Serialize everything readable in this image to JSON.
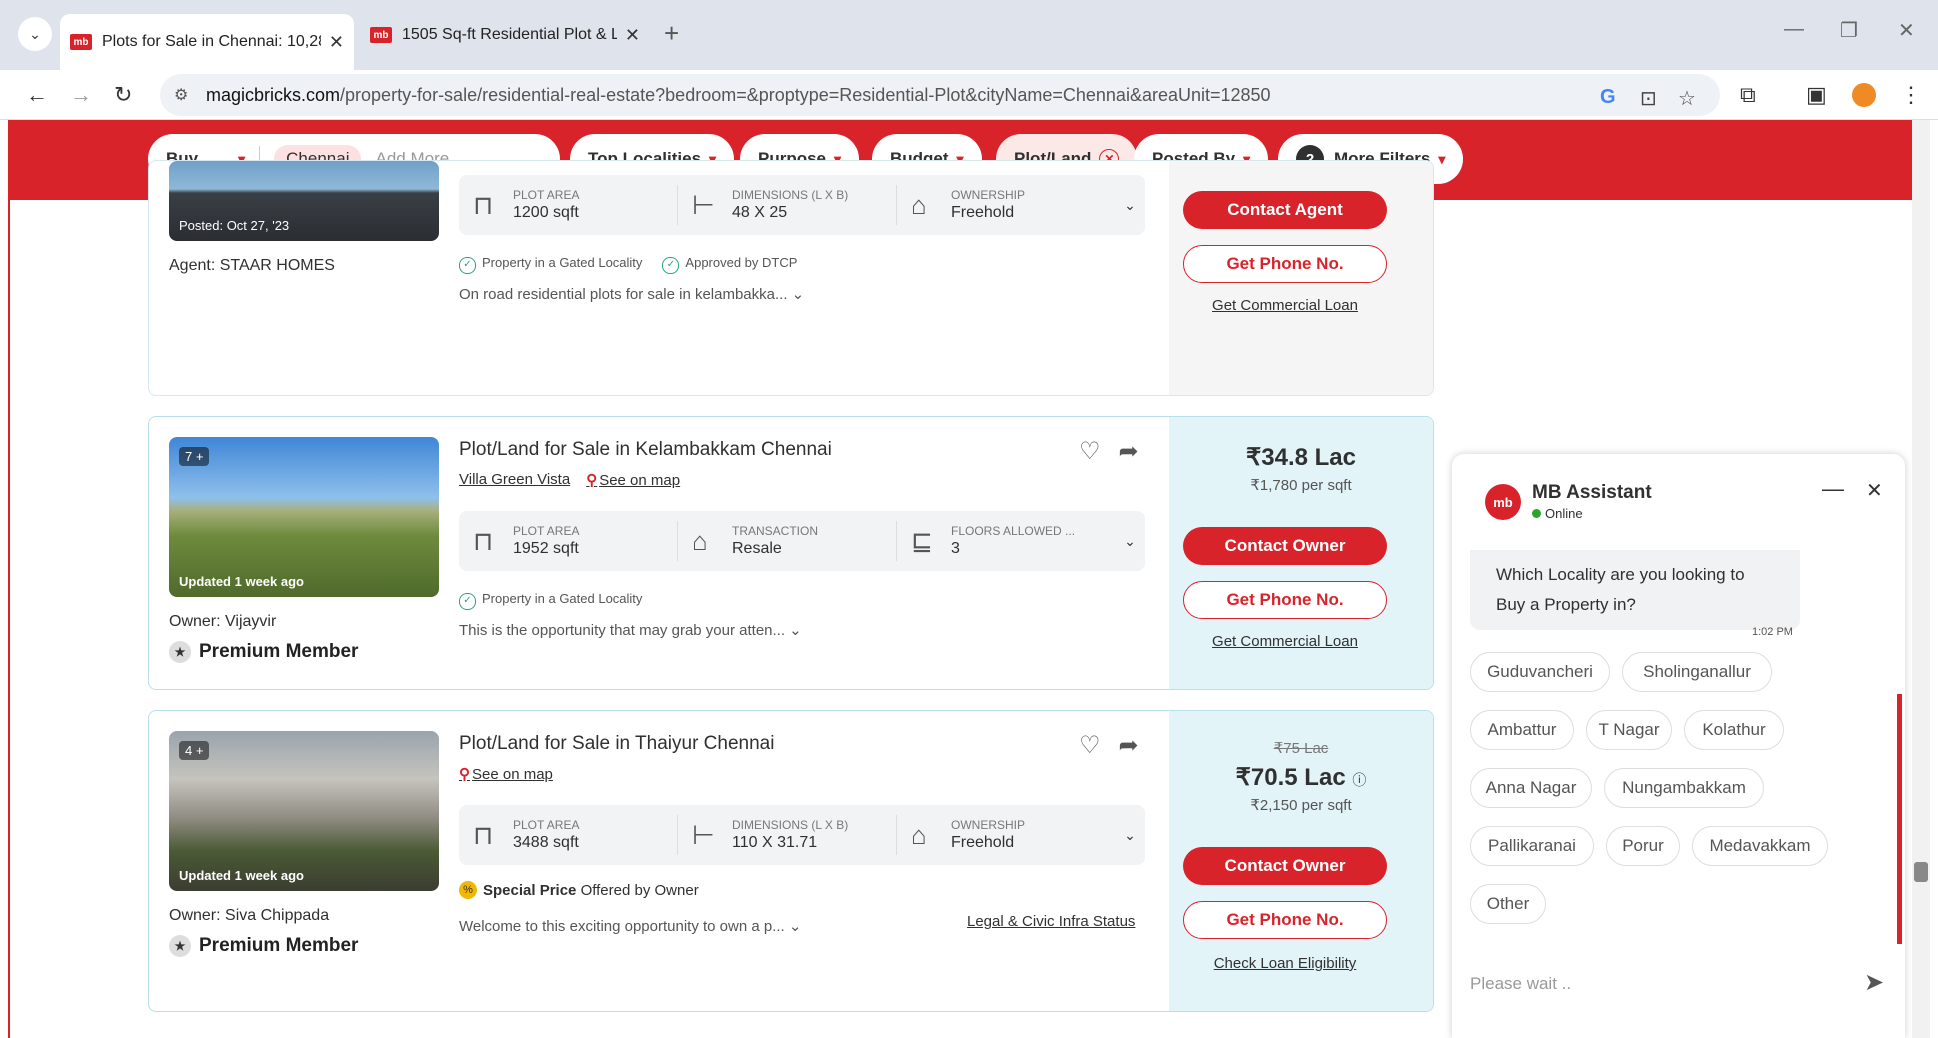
{
  "browser": {
    "tabs": [
      {
        "label": "Plots for Sale in Chennai: 10,28",
        "active": true
      },
      {
        "label": "1505 Sq-ft Residential Plot & L",
        "active": false
      }
    ],
    "url_domain": "magicbricks.com",
    "url_path": "/property-for-sale/residential-real-estate?bedroom=&proptype=Residential-Plot&cityName=Chennai&areaUnit=12850"
  },
  "filters": {
    "buy": "Buy",
    "city": "Chennai",
    "add_more": "Add More",
    "top_localities": "Top Localities",
    "purpose": "Purpose",
    "budget": "Budget",
    "plot_land": "Plot/Land",
    "posted_by": "Posted By",
    "more_filters_count": "2",
    "more_filters": "More Filters"
  },
  "listings": [
    {
      "posted": "Posted: Oct 27, '23",
      "agent": "Agent: STAAR HOMES",
      "specs": [
        {
          "label": "PLOT AREA",
          "value": "1200 sqft"
        },
        {
          "label": "DIMENSIONS (L X B)",
          "value": "48 X 25"
        },
        {
          "label": "OWNERSHIP",
          "value": "Freehold"
        }
      ],
      "tags": [
        "Property in a Gated Locality",
        "Approved by DTCP"
      ],
      "desc": "On road residential plots for sale in kelambakka...",
      "btn1": "Contact Agent",
      "btn2": "Get Phone No.",
      "loan": "Get Commercial Loan"
    },
    {
      "count": "7 +",
      "updated": "Updated 1 week ago",
      "title": "Plot/Land for Sale in Kelambakkam Chennai",
      "project": "Villa Green Vista",
      "map": "See on map",
      "specs": [
        {
          "label": "PLOT AREA",
          "value": "1952 sqft"
        },
        {
          "label": "TRANSACTION",
          "value": "Resale"
        },
        {
          "label": "FLOORS ALLOWED ...",
          "value": "3"
        }
      ],
      "tags": [
        "Property in a Gated Locality"
      ],
      "desc": "This is the opportunity that may grab your atten...",
      "price": "₹34.8 Lac",
      "psf": "₹1,780 per sqft",
      "owner": "Owner: Vijayvir",
      "member": "Premium Member",
      "btn1": "Contact Owner",
      "btn2": "Get Phone No.",
      "loan": "Get Commercial Loan"
    },
    {
      "count": "4 +",
      "updated": "Updated 1 week ago",
      "title": "Plot/Land for Sale in Thaiyur Chennai",
      "map": "See on map",
      "specs": [
        {
          "label": "PLOT AREA",
          "value": "3488 sqft"
        },
        {
          "label": "DIMENSIONS (L X B)",
          "value": "110 X 31.71"
        },
        {
          "label": "OWNERSHIP",
          "value": "Freehold"
        }
      ],
      "special": "Special Price",
      "special_by": "Offered by Owner",
      "desc": "Welcome to this exciting opportunity to own a p...",
      "legal": "Legal & Civic Infra Status",
      "old_price": "₹75 Lac",
      "price": "₹70.5 Lac",
      "psf": "₹2,150 per sqft",
      "owner": "Owner: Siva Chippada",
      "member": "Premium Member",
      "btn1": "Contact Owner",
      "btn2": "Get Phone No.",
      "loan": "Check Loan Eligibility"
    }
  ],
  "chat": {
    "title": "MB Assistant",
    "status": "Online",
    "logo": "mb",
    "question": "Which Locality are you looking to Buy a Property in?",
    "time": "1:02 PM",
    "localities": [
      "Guduvancheri",
      "Sholinganallur",
      "Ambattur",
      "T Nagar",
      "Kolathur",
      "Anna Nagar",
      "Nungambakkam",
      "Pallikaranai",
      "Porur",
      "Medavakkam",
      "Other"
    ],
    "input_placeholder": "Please wait .."
  }
}
